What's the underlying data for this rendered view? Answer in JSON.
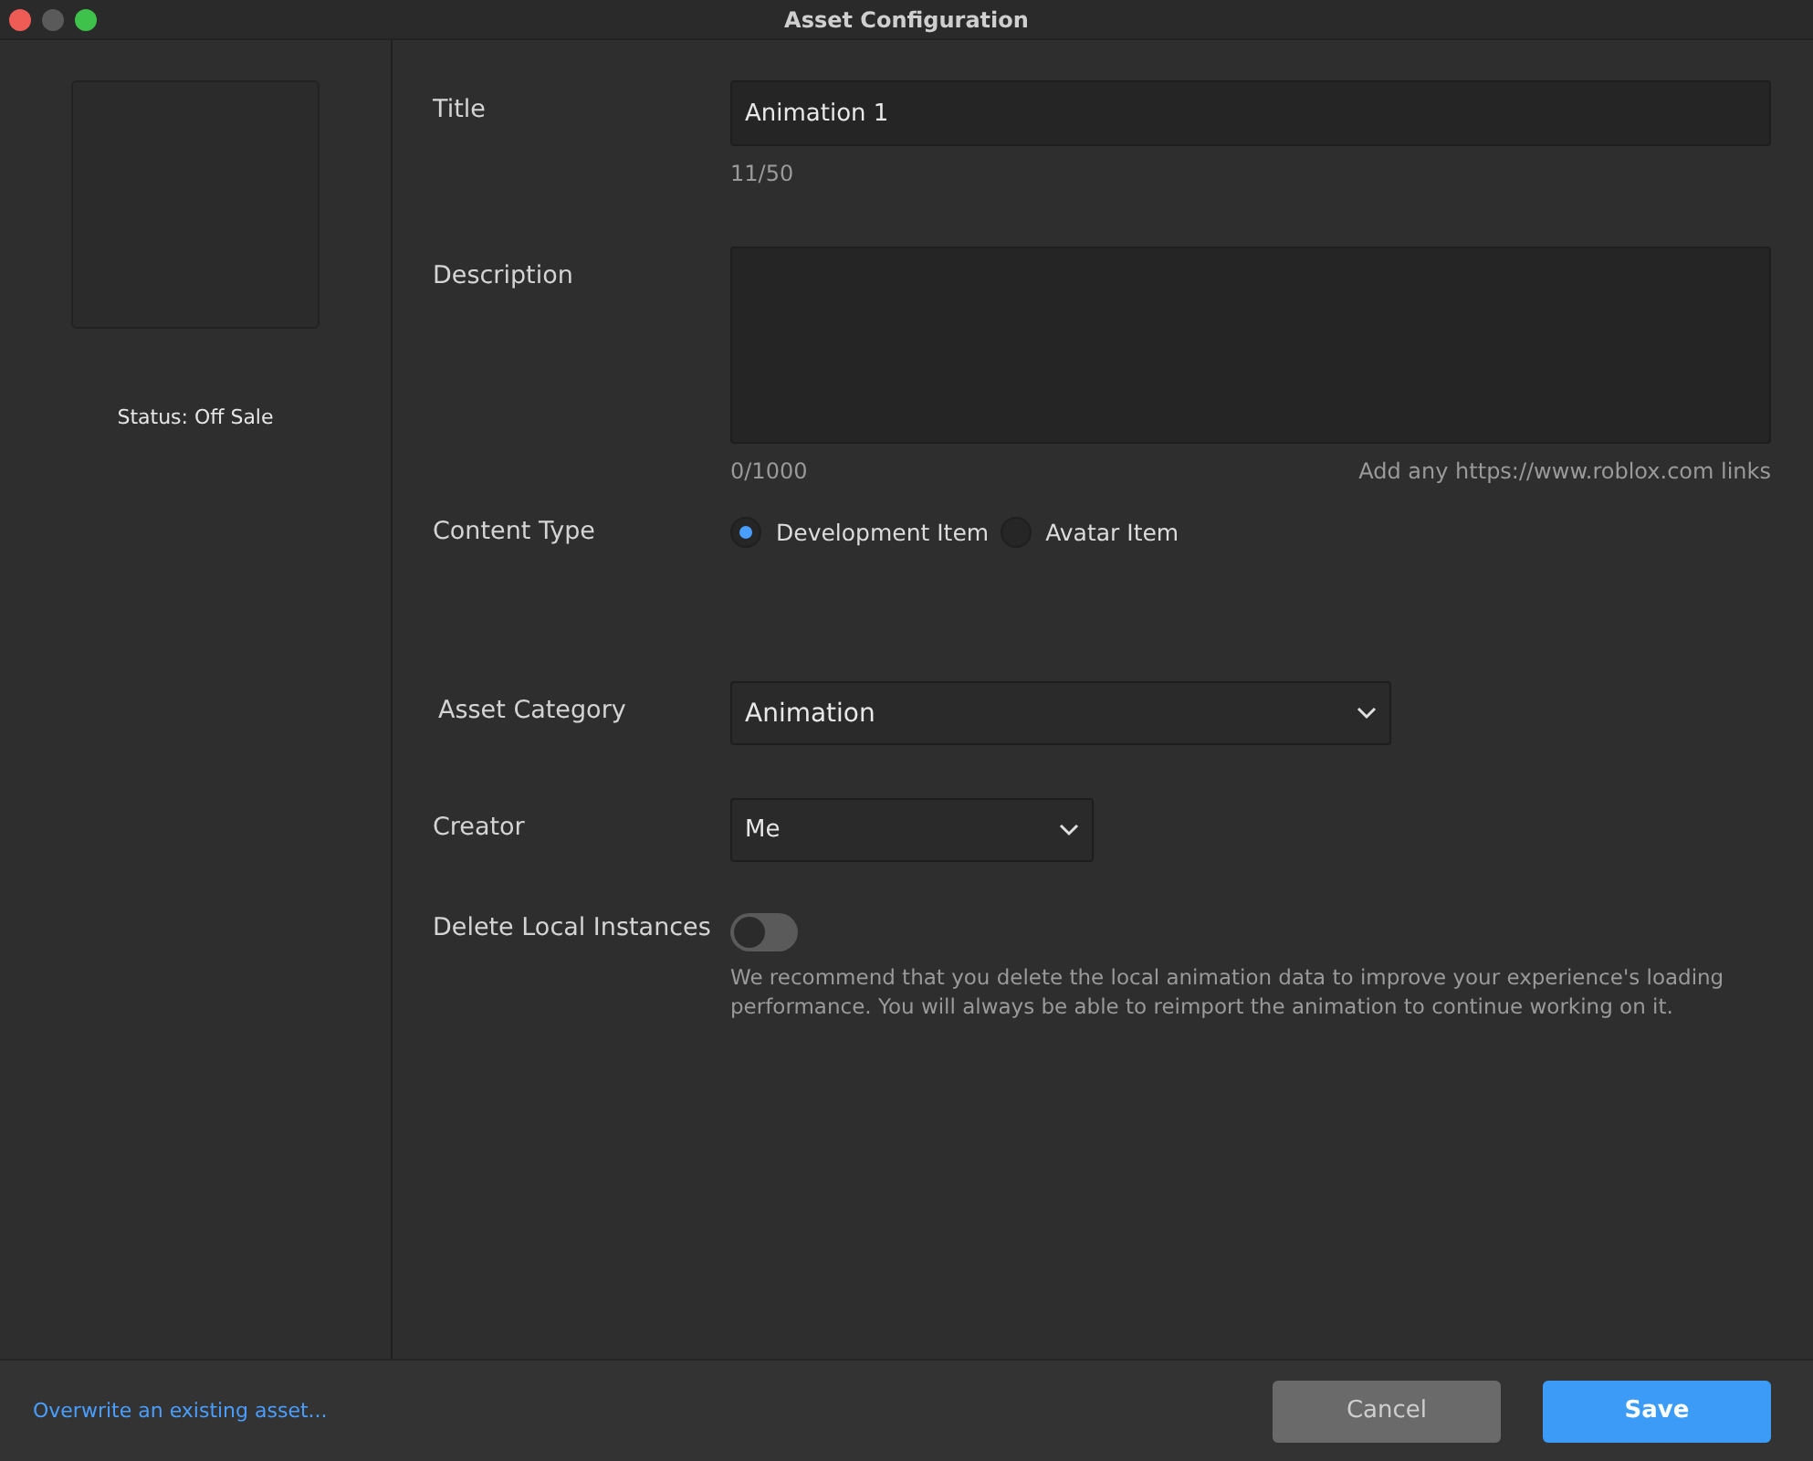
{
  "window": {
    "title": "Asset Configuration"
  },
  "preview": {
    "status": "Status: Off Sale"
  },
  "form": {
    "title": {
      "label": "Title",
      "value": "Animation 1",
      "counter": "11/50"
    },
    "description": {
      "label": "Description",
      "counter": "0/1000",
      "hint": "Add any https://www.roblox.com links"
    },
    "content_type": {
      "label": "Content Type",
      "options": [
        {
          "label": "Development Item",
          "selected": true
        },
        {
          "label": "Avatar Item",
          "selected": false
        }
      ]
    },
    "asset_category": {
      "label": "Asset Category",
      "value": "Animation"
    },
    "creator": {
      "label": "Creator",
      "value": "Me"
    },
    "delete_local": {
      "label": "Delete Local Instances",
      "on": false,
      "note": "We recommend that you delete the local animation data to improve your experience's loading performance. You will always be able to reimport the animation to continue working on it."
    }
  },
  "footer": {
    "link": "Overwrite an existing asset...",
    "buttons": [
      {
        "label": "Cancel",
        "kind": "secondary"
      },
      {
        "label": "Save",
        "kind": "primary"
      }
    ]
  }
}
